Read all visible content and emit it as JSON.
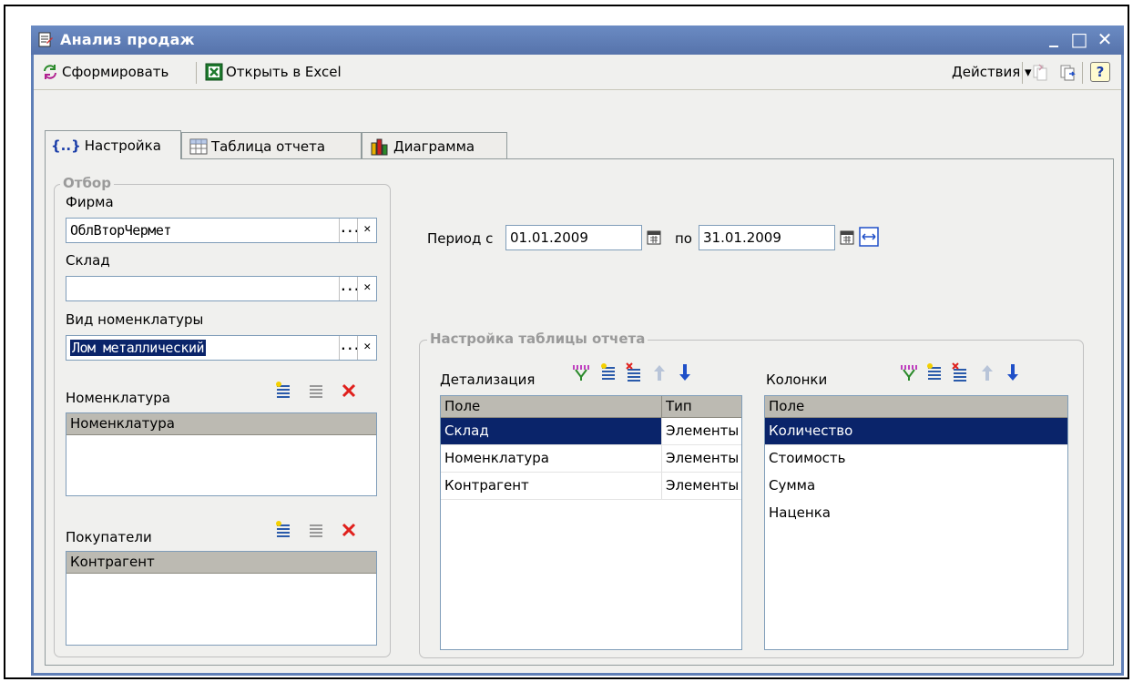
{
  "window": {
    "title": "Анализ продаж",
    "minimize": "_",
    "maximize": "□",
    "close": "✕"
  },
  "toolbar": {
    "generate": "Сформировать",
    "excel": "Открыть в Excel",
    "actions": "Действия ▾",
    "help": "?"
  },
  "tabs": [
    {
      "label": "Настройка"
    },
    {
      "label": "Таблица отчета"
    },
    {
      "label": "Диаграмма"
    }
  ],
  "filter": {
    "title": "Отбор",
    "firm_label": "Фирма",
    "firm_value": "ОблВторЧермет",
    "warehouse_label": "Склад",
    "warehouse_value": "",
    "nomtype_label": "Вид номенклатуры",
    "nomtype_value": "Лом металлический",
    "nomenclature_label": "Номенклатура",
    "nomenclature_header": "Номенклатура",
    "buyers_label": "Покупатели",
    "buyers_header": "Контрагент",
    "dots": "...",
    "clear": "✕"
  },
  "period": {
    "from_label": "Период с",
    "from_value": "01.01.2009",
    "to_label": "по",
    "to_value": "31.01.2009"
  },
  "report_settings": {
    "title": "Настройка таблицы отчета",
    "detail_label": "Детализация",
    "detail_headers": [
      "Поле",
      "Тип"
    ],
    "detail_rows": [
      {
        "field": "Склад",
        "type": "Элементы"
      },
      {
        "field": "Номенклатура",
        "type": "Элементы"
      },
      {
        "field": "Контрагент",
        "type": "Элементы"
      }
    ],
    "columns_label": "Колонки",
    "columns_header": "Поле",
    "columns_rows": [
      "Количество",
      "Стоимость",
      "Сумма",
      "Наценка"
    ]
  },
  "colors": {
    "title_bar": "#5f7fb7",
    "selection": "#0a246a",
    "delete_red": "#e0201c",
    "arrow_blue": "#1f4fc8"
  }
}
